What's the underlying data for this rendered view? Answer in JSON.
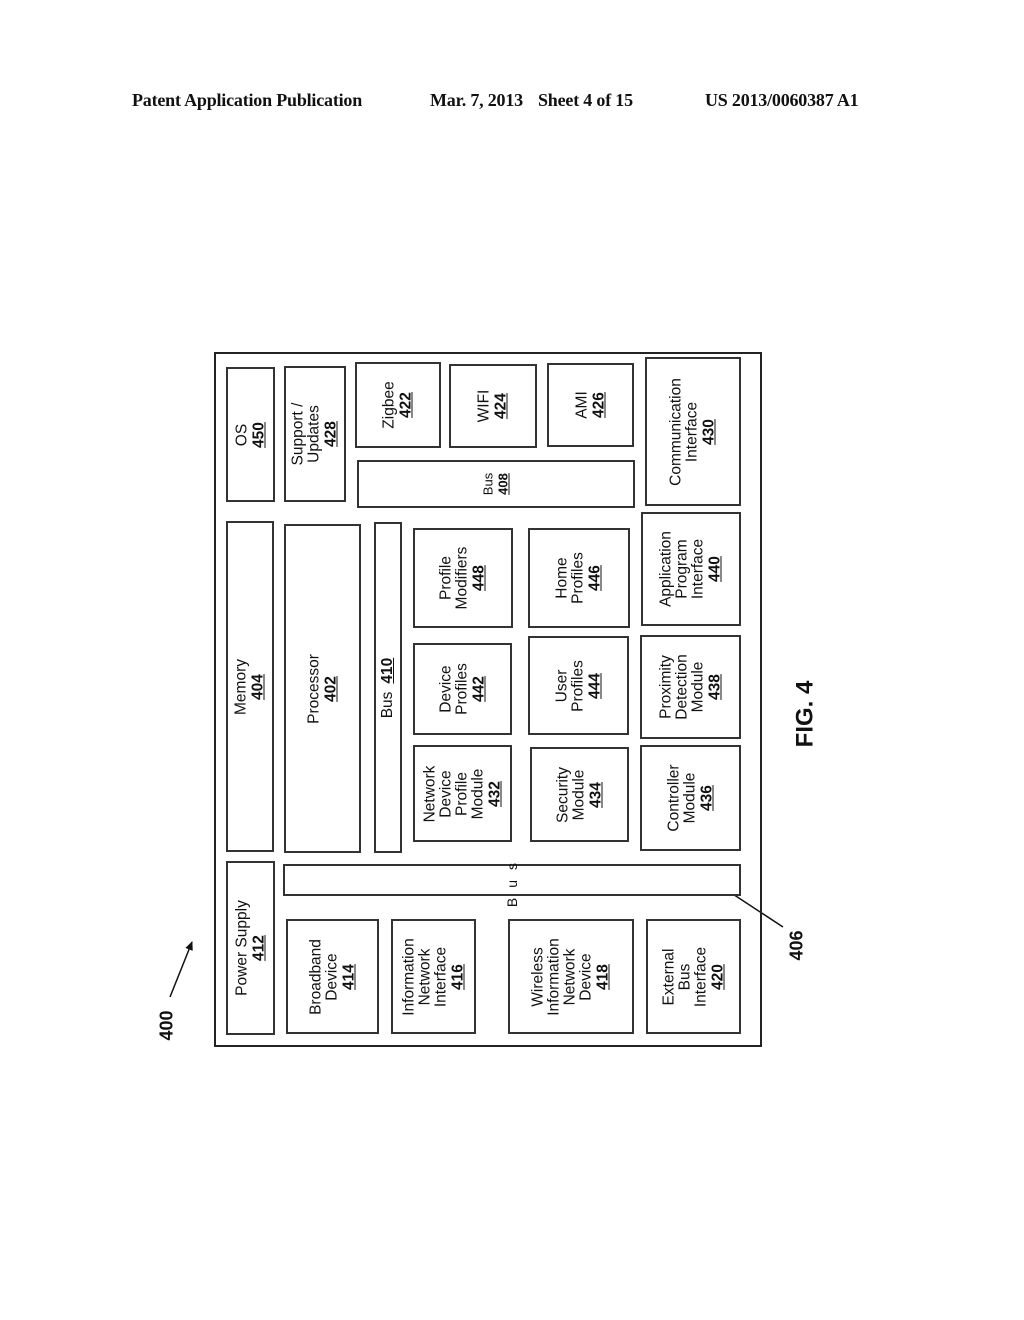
{
  "header": {
    "publication": "Patent Application Publication",
    "date": "Mar. 7, 2013",
    "sheet": "Sheet 4 of 15",
    "number": "US 2013/0060387 A1"
  },
  "figure": {
    "label": "FIG. 4",
    "ref_system": "400",
    "ref_bus": "406"
  },
  "blocks": {
    "os": {
      "label": "OS",
      "num": "450"
    },
    "support": {
      "label1": "Support /",
      "label2": "Updates",
      "num": "428"
    },
    "zigbee": {
      "label": "Zigbee",
      "num": "422"
    },
    "wifi": {
      "label": "WIFI",
      "num": "424"
    },
    "ami": {
      "label": "AMI",
      "num": "426"
    },
    "bus408": {
      "label": "Bus",
      "num": "408"
    },
    "comm": {
      "label1": "Communication",
      "label2": "Interface",
      "num": "430"
    },
    "memory": {
      "label": "Memory",
      "num": "404"
    },
    "processor": {
      "label": "Processor",
      "num": "402"
    },
    "bus410": {
      "label": "Bus",
      "num": "410"
    },
    "profile_modifiers": {
      "label1": "Profile",
      "label2": "Modifiers",
      "num": "448"
    },
    "home_profiles": {
      "label1": "Home",
      "label2": "Profiles",
      "num": "446"
    },
    "api": {
      "label1": "Application",
      "label2": "Program",
      "label3": "Interface",
      "num": "440"
    },
    "device_profiles": {
      "label1": "Device",
      "label2": "Profiles",
      "num": "442"
    },
    "user_profiles": {
      "label1": "User",
      "label2": "Profiles",
      "num": "444"
    },
    "proximity": {
      "label1": "Proximity",
      "label2": "Detection",
      "label3": "Module",
      "num": "438"
    },
    "ndpm": {
      "label1": "Network",
      "label2": "Device",
      "label3": "Profile",
      "label4": "Module",
      "num": "432"
    },
    "security": {
      "label1": "Security",
      "label2": "Module",
      "num": "434"
    },
    "controller": {
      "label1": "Controller",
      "label2": "Module",
      "num": "436"
    },
    "power": {
      "label": "Power Supply",
      "num": "412"
    },
    "bus406": {
      "label": "Bus"
    },
    "broadband": {
      "label1": "Broadband",
      "label2": "Device",
      "num": "414"
    },
    "info_net": {
      "label1": "Information",
      "label2": "Network",
      "label3": "Interface",
      "num": "416"
    },
    "wireless": {
      "label1": "Wireless",
      "label2": "Information",
      "label3": "Network",
      "label4": "Device",
      "num": "418"
    },
    "external_bus": {
      "label1": "External",
      "label2": "Bus",
      "label3": "Interface",
      "num": "420"
    }
  }
}
